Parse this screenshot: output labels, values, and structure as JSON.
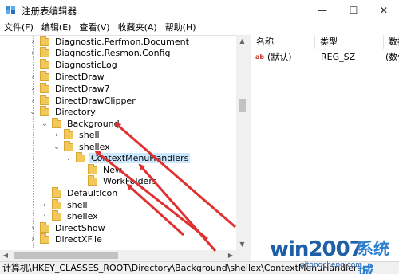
{
  "window": {
    "title": "注册表编辑器",
    "minimize": "—",
    "maximize": "☐",
    "close": "✕"
  },
  "menu": [
    "文件(F)",
    "编辑(E)",
    "查看(V)",
    "收藏夹(A)",
    "帮助(H)"
  ],
  "tree": {
    "rows": [
      {
        "label": "Diagnostic.Perfmon.Document",
        "arrow": "›"
      },
      {
        "label": "Diagnostic.Resmon.Config",
        "arrow": "›"
      },
      {
        "label": "DiagnosticLog",
        "arrow": ""
      },
      {
        "label": "DirectDraw",
        "arrow": "›"
      },
      {
        "label": "DirectDraw7",
        "arrow": "›"
      },
      {
        "label": "DirectDrawClipper",
        "arrow": "›"
      },
      {
        "label": "Directory",
        "arrow": "⌄"
      },
      {
        "label": "Background",
        "arrow": "⌄"
      },
      {
        "label": "shell",
        "arrow": "›"
      },
      {
        "label": "shellex",
        "arrow": "⌄"
      },
      {
        "label": "ContextMenuHandlers",
        "arrow": "⌄"
      },
      {
        "label": "New",
        "arrow": ""
      },
      {
        "label": "WorkFolders",
        "arrow": ""
      },
      {
        "label": "DefaultIcon",
        "arrow": ""
      },
      {
        "label": "shell",
        "arrow": "›"
      },
      {
        "label": "shellex",
        "arrow": "›"
      },
      {
        "label": "DirectShow",
        "arrow": "›"
      },
      {
        "label": "DirectXFile",
        "arrow": "›"
      }
    ]
  },
  "values": {
    "headers": {
      "name": "名称",
      "type": "类型",
      "data": "数据"
    },
    "rows": [
      {
        "icon": "ab",
        "name": "(默认)",
        "type": "REG_SZ",
        "data": "(数值"
      }
    ]
  },
  "statusbar": {
    "path": "计算机\\HKEY_CLASSES_ROOT\\Directory\\Background\\shellex\\ContextMenuHandlers"
  },
  "watermark": {
    "main": "win2007",
    "cn": "系统城",
    "sub": "xitongcheng.com"
  },
  "colors": {
    "selection": "#cce8ff",
    "folder": "#f3c85b",
    "arrow_annotation": "#e0302f"
  }
}
